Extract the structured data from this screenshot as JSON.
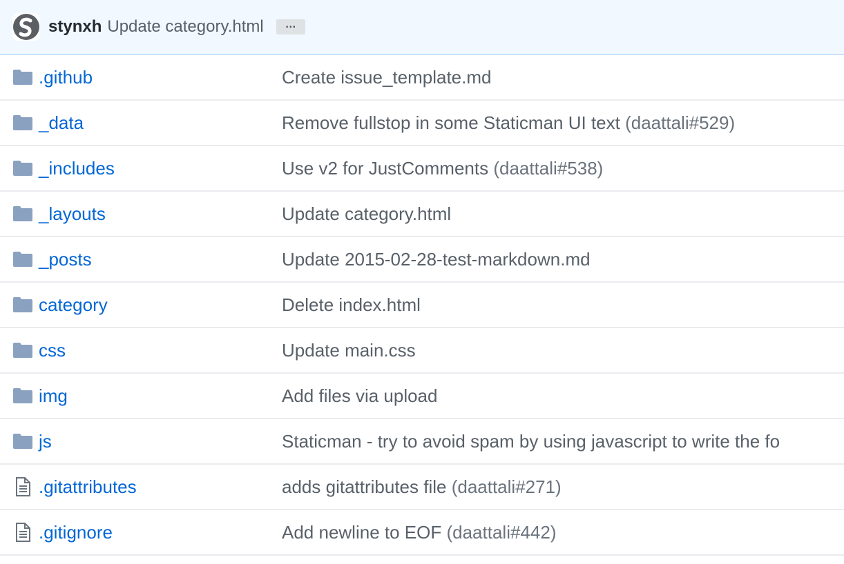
{
  "commit": {
    "author": "stynxh",
    "message": "Update category.html",
    "ellipsis": "…"
  },
  "files": [
    {
      "type": "dir",
      "name": ".github",
      "message": "Create issue_template.md",
      "issue": ""
    },
    {
      "type": "dir",
      "name": "_data",
      "message": "Remove fullstop in some Staticman UI text",
      "issue": "daattali#529"
    },
    {
      "type": "dir",
      "name": "_includes",
      "message": "Use v2 for JustComments",
      "issue": "daattali#538"
    },
    {
      "type": "dir",
      "name": "_layouts",
      "message": "Update category.html",
      "issue": ""
    },
    {
      "type": "dir",
      "name": "_posts",
      "message": "Update 2015-02-28-test-markdown.md",
      "issue": ""
    },
    {
      "type": "dir",
      "name": "category",
      "message": "Delete index.html",
      "issue": ""
    },
    {
      "type": "dir",
      "name": "css",
      "message": "Update main.css",
      "issue": ""
    },
    {
      "type": "dir",
      "name": "img",
      "message": "Add files via upload",
      "issue": ""
    },
    {
      "type": "dir",
      "name": "js",
      "message": "Staticman - try to avoid spam by using javascript to write the fo",
      "issue": ""
    },
    {
      "type": "file",
      "name": ".gitattributes",
      "message": "adds gitattributes file",
      "issue": "daattali#271"
    },
    {
      "type": "file",
      "name": ".gitignore",
      "message": "Add newline to EOF",
      "issue": "daattali#442"
    }
  ],
  "colors": {
    "link": "#0366d6",
    "folder": "#79b8ff",
    "muted": "#586069",
    "header_bg": "#f1f8ff"
  },
  "icons": {
    "dir": "folder-icon",
    "file": "file-text-icon"
  }
}
